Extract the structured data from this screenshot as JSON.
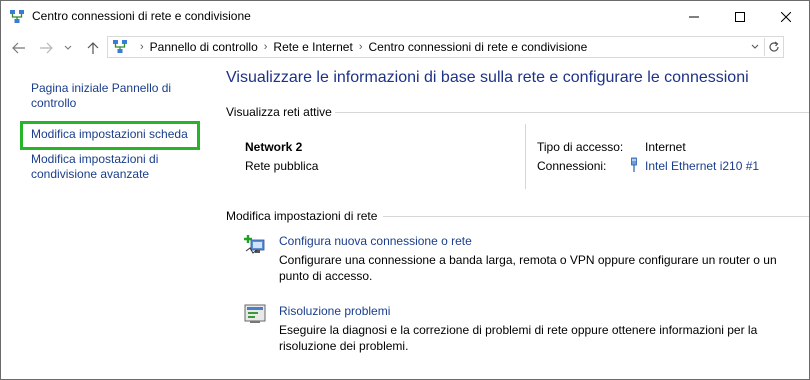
{
  "window": {
    "title": "Centro connessioni di rete e condivisione"
  },
  "address_bar": {
    "crumbs": [
      "Pannello di controllo",
      "Rete e Internet",
      "Centro connessioni di rete e condivisione"
    ]
  },
  "sidebar": {
    "items": [
      {
        "label": "Pagina iniziale Pannello di controllo"
      },
      {
        "label": "Modifica impostazioni scheda",
        "highlighted": true
      },
      {
        "label": "Modifica impostazioni di condivisione avanzate"
      }
    ],
    "highlight_color": "#28b428"
  },
  "main": {
    "title": "Visualizzare le informazioni di base sulla rete e configurare le connessioni",
    "active_networks": {
      "heading": "Visualizza reti attive",
      "network_name": "Network  2",
      "network_type": "Rete pubblica",
      "access_type_label": "Tipo di accesso:",
      "access_type_value": "Internet",
      "connections_label": "Connessioni:",
      "connection_name": "Intel Ethernet i210 #1"
    },
    "change_settings": {
      "heading": "Modifica impostazioni di rete",
      "tasks": [
        {
          "icon": "new-connection-icon",
          "title": "Configura nuova connessione o rete",
          "description": "Configurare una connessione a banda larga, remota o VPN oppure configurare un router o un punto di accesso."
        },
        {
          "icon": "troubleshoot-icon",
          "title": "Risoluzione problemi",
          "description": "Eseguire la diagnosi e la correzione di problemi di rete oppure ottenere informazioni per la risoluzione dei problemi."
        }
      ]
    }
  },
  "colors": {
    "link": "#1a3e8c",
    "title": "#1e3287"
  }
}
